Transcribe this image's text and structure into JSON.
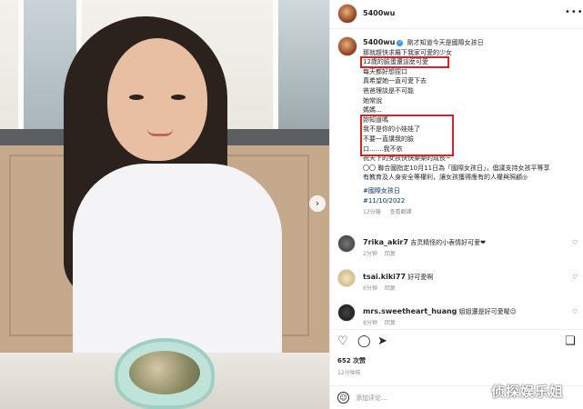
{
  "post": {
    "username": "5400wu",
    "more_icon": "more-horizontal-icon",
    "next_icon": "chevron-right-icon"
  },
  "caption": {
    "username": "5400wu",
    "first_line": "剛才知道今天是國際女孩日",
    "lines": [
      "那就趕快求羅下我家可愛的少女",
      "12歲的臉蛋還這麼可愛",
      "每天都好想捏口",
      "真希望她一直可愛下去",
      "爸爸理談是不可能",
      "她常說",
      "媽媽...",
      "妳知道嗎",
      "我不是你的小娃娃了",
      "不要一直講我的臉",
      "口.......我不依",
      "祝天下的女孩快快樂樂的成長~",
      "〇〇 聯合國指定10月11日為「國際女孩日」，倡議支持女孩平等享",
      "有教育及人身安全等權利，讓女孩獲得應有的人權與照顧◎"
    ],
    "hashtag": "#國際女孩日",
    "date_tag": "#11/10/2022",
    "meta_time": "12分鐘",
    "meta_translate": "查看翻譯"
  },
  "comments": [
    {
      "username": "7rika_akir7",
      "text": "吉灵精怪的小表情好可爱❤",
      "time": "2分钟",
      "reply": "回复"
    },
    {
      "username": "tsai.kiki77",
      "text": "好可愛啊",
      "time": "6分钟",
      "reply": "回复"
    },
    {
      "username": "mrs.sweetheart_huang",
      "text": "姐姐還是好可愛喔☺",
      "time": "8分钟",
      "reply": "回复"
    }
  ],
  "actions": {
    "like_icon": "heart-icon",
    "comment_icon": "comment-icon",
    "share_icon": "share-icon",
    "save_icon": "bookmark-icon"
  },
  "likes": "652 次赞",
  "time": "12分钟前",
  "add_comment": {
    "placeholder": "添加评论..."
  },
  "watermark": "侦探娱乐姐"
}
